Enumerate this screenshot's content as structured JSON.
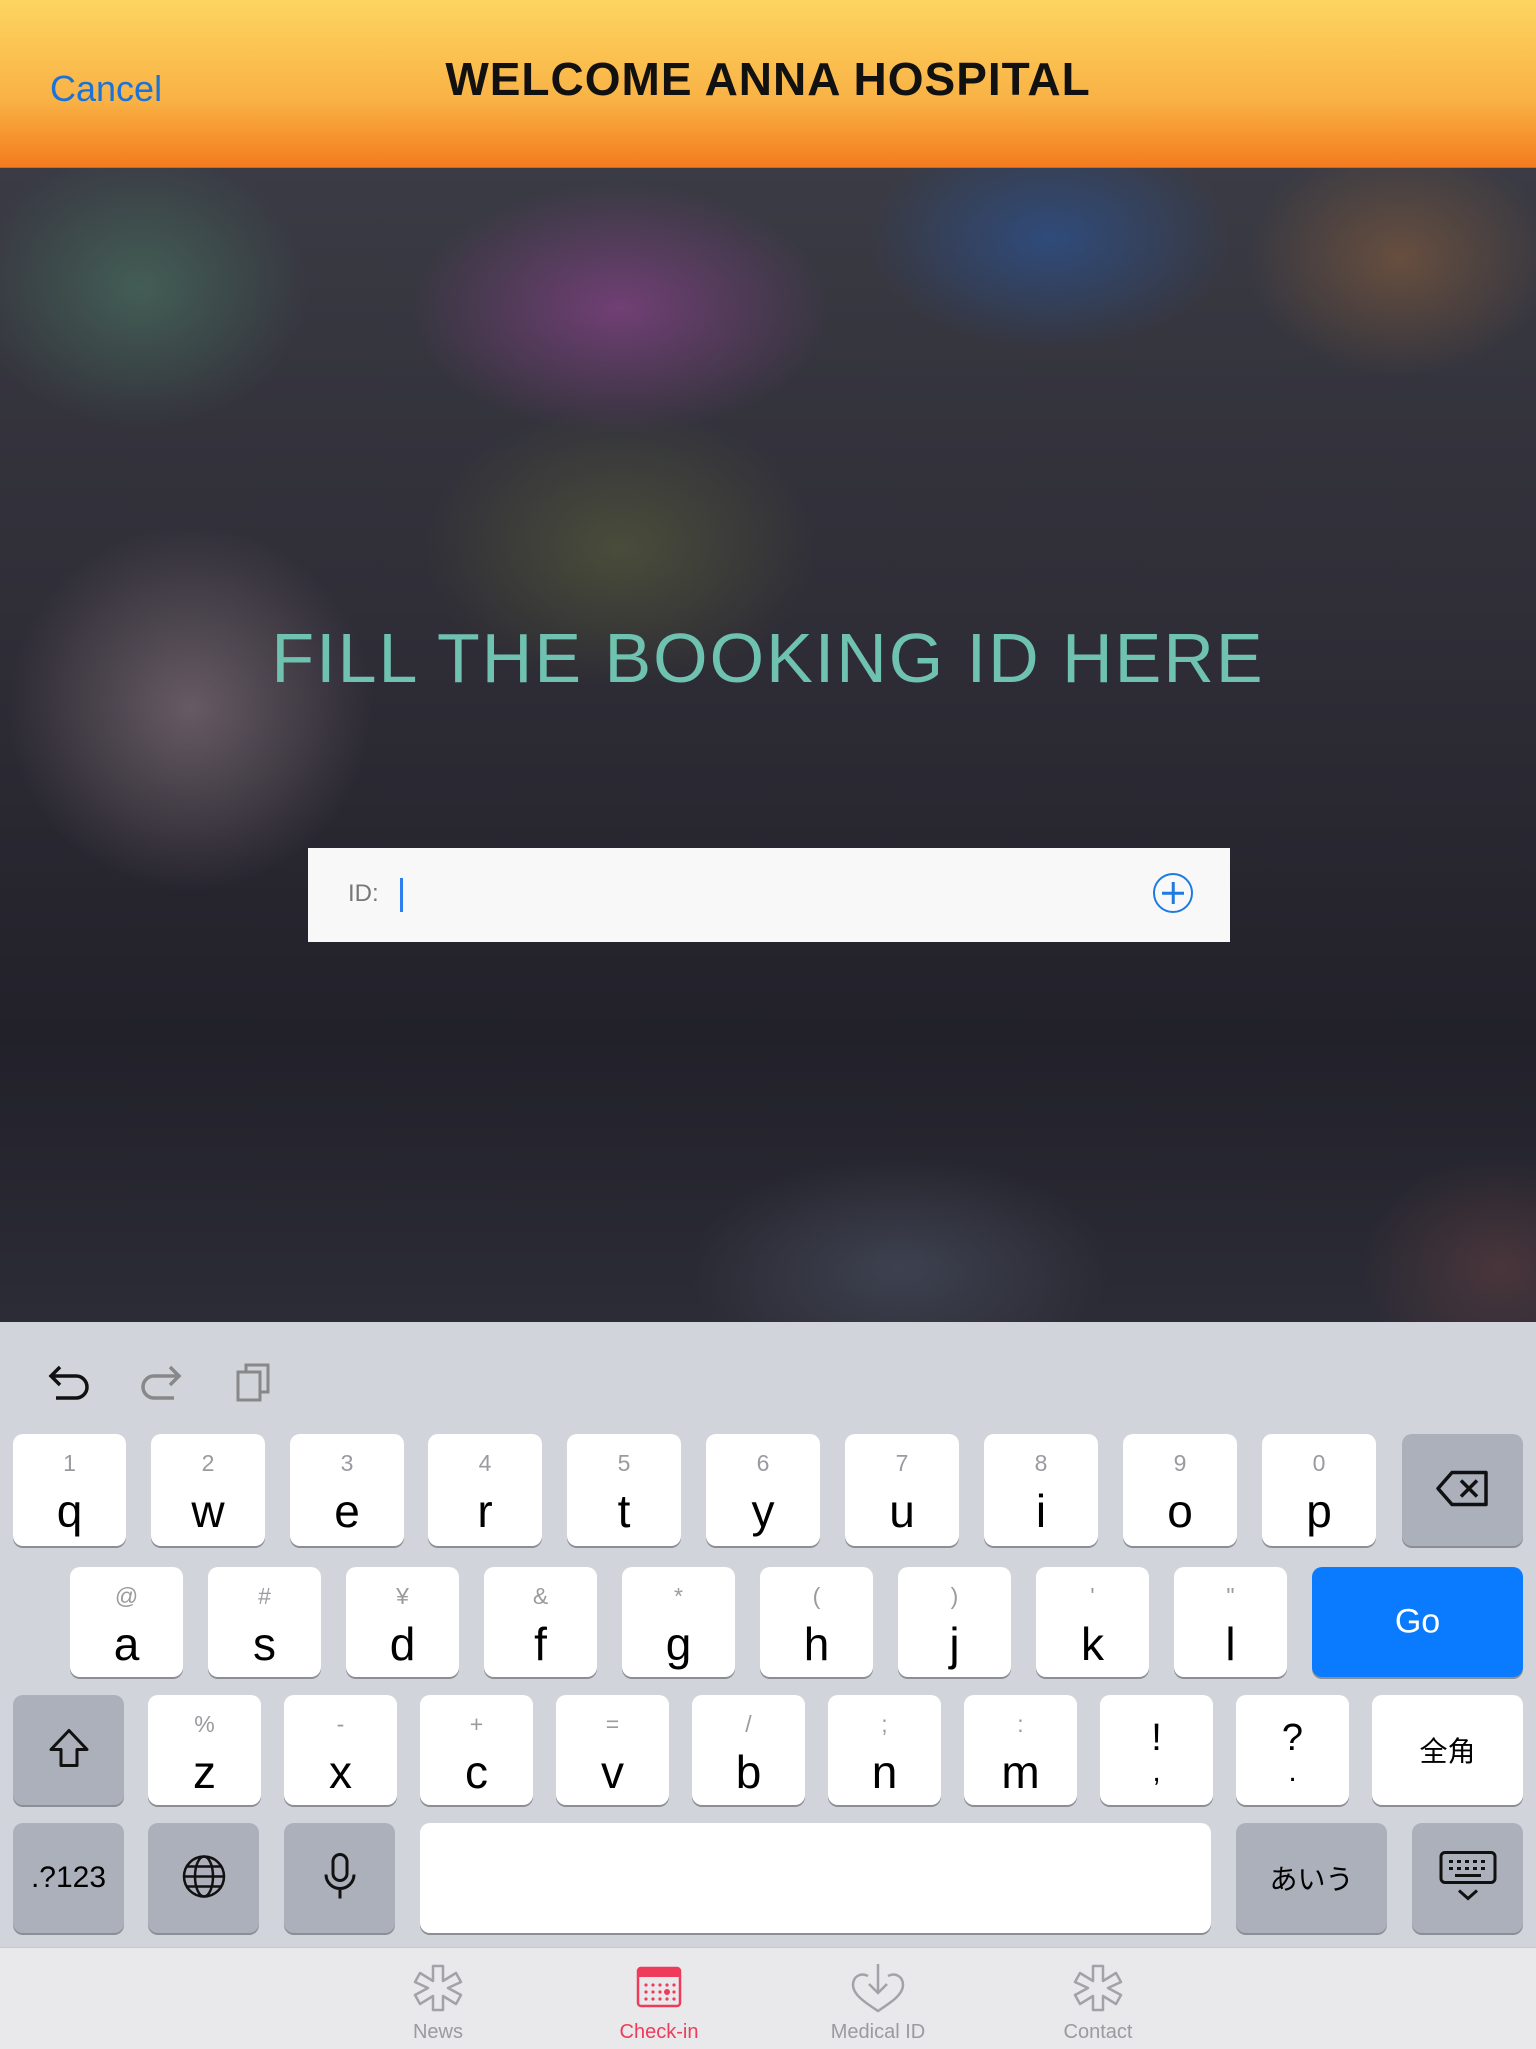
{
  "header": {
    "cancel_label": "Cancel",
    "title": "WELCOME ANNA HOSPITAL"
  },
  "main": {
    "headline": "FILL THE BOOKING ID HERE",
    "id_field": {
      "label": "ID:",
      "value": "",
      "placeholder": ""
    }
  },
  "keyboard": {
    "row1": [
      {
        "key": "q",
        "hint": "1"
      },
      {
        "key": "w",
        "hint": "2"
      },
      {
        "key": "e",
        "hint": "3"
      },
      {
        "key": "r",
        "hint": "4"
      },
      {
        "key": "t",
        "hint": "5"
      },
      {
        "key": "y",
        "hint": "6"
      },
      {
        "key": "u",
        "hint": "7"
      },
      {
        "key": "i",
        "hint": "8"
      },
      {
        "key": "o",
        "hint": "9"
      },
      {
        "key": "p",
        "hint": "0"
      }
    ],
    "row2": [
      {
        "key": "a",
        "hint": "@"
      },
      {
        "key": "s",
        "hint": "#"
      },
      {
        "key": "d",
        "hint": "¥"
      },
      {
        "key": "f",
        "hint": "&"
      },
      {
        "key": "g",
        "hint": "*"
      },
      {
        "key": "h",
        "hint": "("
      },
      {
        "key": "j",
        "hint": ")"
      },
      {
        "key": "k",
        "hint": "'"
      },
      {
        "key": "l",
        "hint": "\""
      }
    ],
    "row3": [
      {
        "key": "z",
        "hint": "%"
      },
      {
        "key": "x",
        "hint": "-"
      },
      {
        "key": "c",
        "hint": "+"
      },
      {
        "key": "v",
        "hint": "="
      },
      {
        "key": "b",
        "hint": "/"
      },
      {
        "key": "n",
        "hint": ";"
      },
      {
        "key": "m",
        "hint": ":"
      }
    ],
    "exclaim_top": "!",
    "exclaim_bottom": ",",
    "question_top": "?",
    "question_bottom": ".",
    "go_label": "Go",
    "zenkaku_label": "全角",
    "numbers_label": ".?123",
    "kana_label": "あいう"
  },
  "tabbar": {
    "tabs": [
      {
        "label": "News",
        "icon": "asterisk-icon",
        "active": false
      },
      {
        "label": "Check-in",
        "icon": "calendar-icon",
        "active": true
      },
      {
        "label": "Medical ID",
        "icon": "heart-download-icon",
        "active": false
      },
      {
        "label": "Contact",
        "icon": "asterisk-icon",
        "active": false
      }
    ],
    "active_color": "#ef3b5a"
  },
  "colors": {
    "header_top": "#fdd460",
    "header_bottom": "#f47b1f",
    "accent_blue": "#1a73d9",
    "headline": "#6fc1b0",
    "go_key": "#0a7bff"
  }
}
